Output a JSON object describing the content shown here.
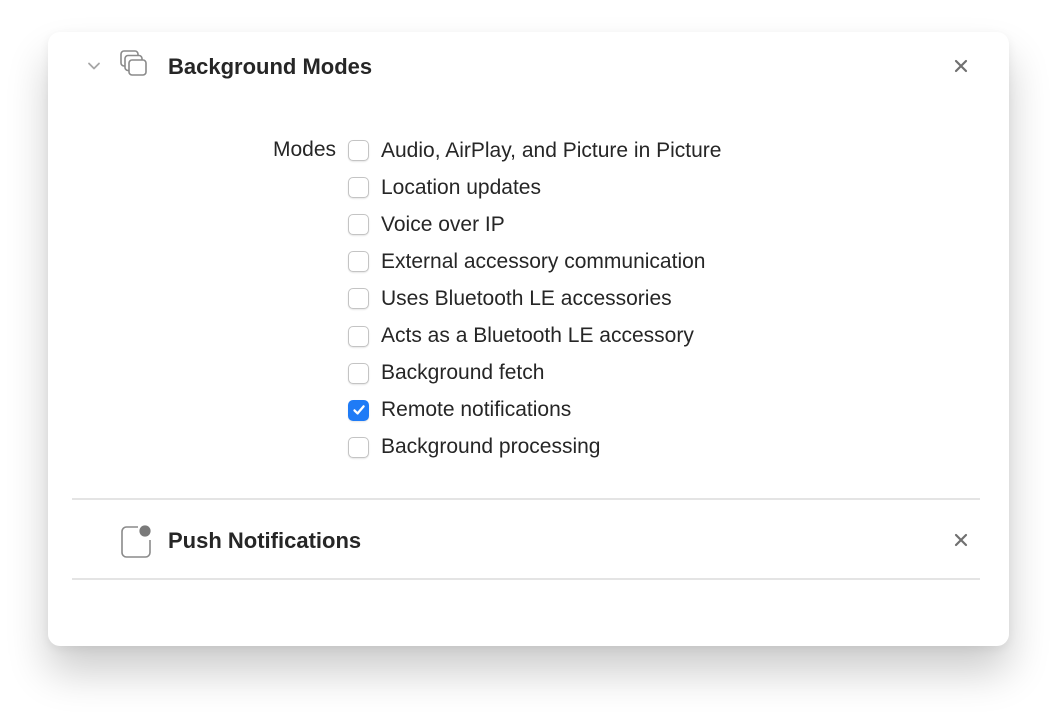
{
  "background_modes": {
    "title": "Background Modes",
    "icon": "stacked-windows-icon",
    "expanded": true,
    "modes_label": "Modes",
    "modes": [
      {
        "label": "Audio, AirPlay, and Picture in Picture",
        "checked": false
      },
      {
        "label": "Location updates",
        "checked": false
      },
      {
        "label": "Voice over IP",
        "checked": false
      },
      {
        "label": "External accessory communication",
        "checked": false
      },
      {
        "label": "Uses Bluetooth LE accessories",
        "checked": false
      },
      {
        "label": "Acts as a Bluetooth LE accessory",
        "checked": false
      },
      {
        "label": "Background fetch",
        "checked": false
      },
      {
        "label": "Remote notifications",
        "checked": true
      },
      {
        "label": "Background processing",
        "checked": false
      }
    ]
  },
  "push_notifications": {
    "title": "Push Notifications",
    "icon": "notification-badge-icon"
  },
  "colors": {
    "accent": "#1f7bf6",
    "text": "#262626",
    "divider": "#e4e4e4",
    "icon": "#8a8a8a"
  }
}
